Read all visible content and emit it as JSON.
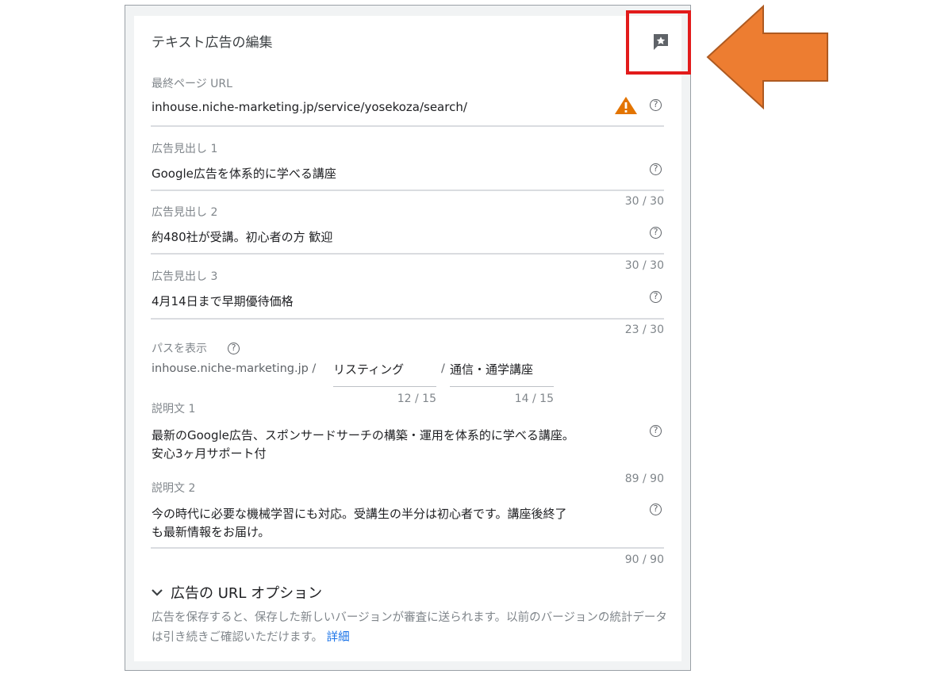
{
  "dialog": {
    "title": "テキスト広告の編集",
    "feedback_icon": "feedback-icon"
  },
  "final_url": {
    "label": "最終ページ URL",
    "value": "inhouse.niche-marketing.jp/service/yosekoza/search/"
  },
  "headline1": {
    "label": "広告見出し 1",
    "value": "Google広告を体系的に学べる講座",
    "counter": "30 / 30"
  },
  "headline2": {
    "label": "広告見出し 2",
    "value": "約480社が受講。初心者の方 歓迎",
    "counter": "30 / 30"
  },
  "headline3": {
    "label": "広告見出し 3",
    "value": "4月14日まで早期優待価格",
    "counter": "23 / 30"
  },
  "display_path": {
    "label": "パスを表示",
    "domain": "inhouse.niche-marketing.jp /",
    "path1": "リスティング",
    "path1_counter": "12 / 15",
    "separator": "/",
    "path2": "通信・通学講座",
    "path2_counter": "14 / 15"
  },
  "description1": {
    "label": "説明文 1",
    "line1": "最新のGoogle広告、スポンサードサーチの構築・運用を体系的に学べる講座。",
    "line2": "安心3ヶ月サポート付",
    "counter": "89 / 90"
  },
  "description2": {
    "label": "説明文 2",
    "line1": "今の時代に必要な機械学習にも対応。受講生の半分は初心者です。講座後終了",
    "line2": "も最新情報をお届け。",
    "counter": "90 / 90"
  },
  "url_options": {
    "label": "広告の URL オプション"
  },
  "footer": {
    "text": "広告を保存すると、保存した新しいバージョンが審査に送られます。以前のバージョンの統計データは引き続きご確認いただけます。",
    "link": "詳細"
  },
  "help_glyph": "?",
  "colors": {
    "highlight": "#e21b1b",
    "arrow": "#ed7d31",
    "warning": "#e37400",
    "link": "#1a73e8"
  }
}
